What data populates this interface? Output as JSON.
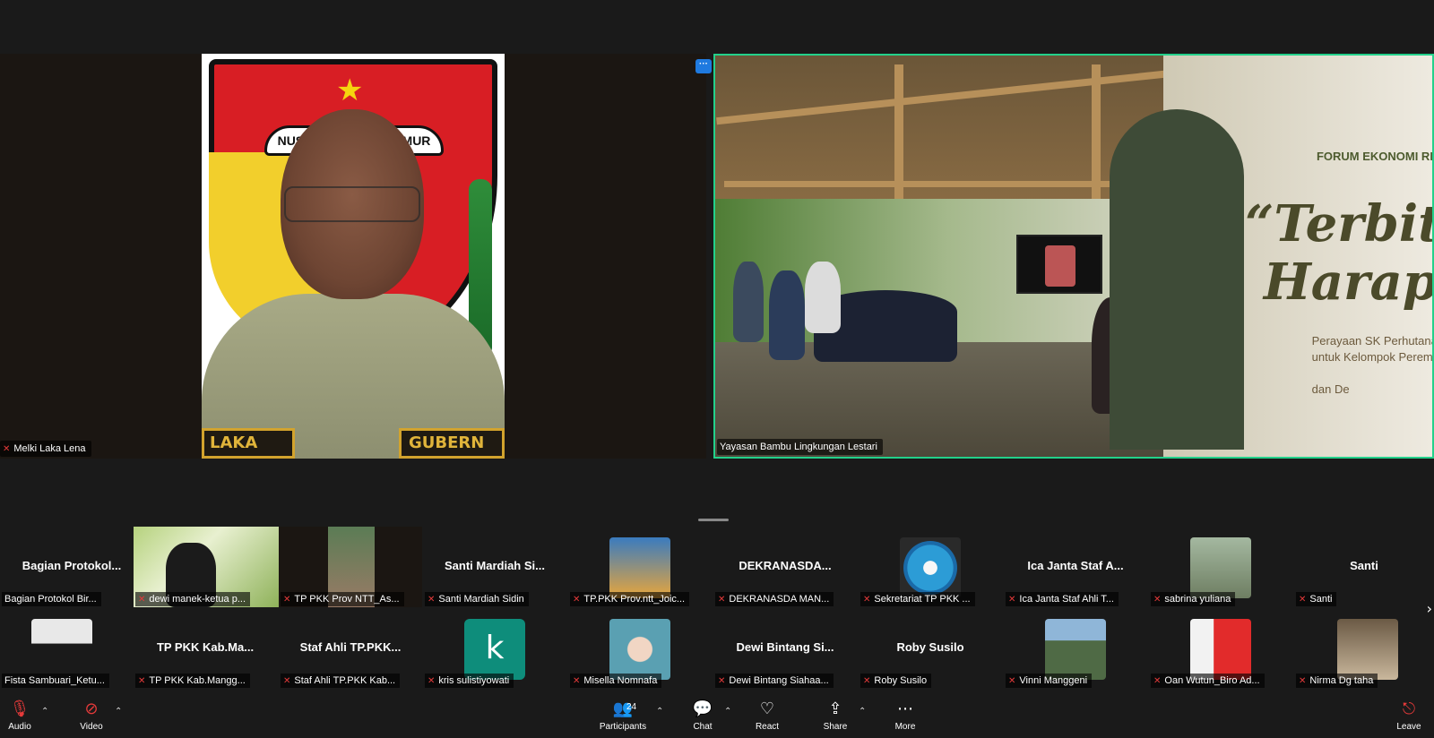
{
  "speakers": {
    "left": {
      "name": "Melki Laka Lena",
      "emblem_text": "NUSA TENGGARA TIMUR",
      "shirt_left": "LAKA LENA",
      "shirt_right": "GUBERN"
    },
    "right": {
      "name": "Yayasan Bambu Lingkungan Lestari",
      "poster_title": "FORUM EKONOMI RE",
      "poster_big1": "“Terbit",
      "poster_big2": "Harap",
      "poster_small": "Perayaan SK Perhutana\nuntuk Kelompok Peremp\n\ndan De"
    },
    "more_button": "···"
  },
  "gallery": {
    "row1": [
      {
        "display": "Bagian Protokol...",
        "label": "Bagian Protokol Bir...",
        "type": "name"
      },
      {
        "display": "",
        "label": "dewi manek-ketua p...",
        "type": "photo-grass"
      },
      {
        "display": "",
        "label": "TP PKK Prov NTT_As...",
        "type": "photo-dark"
      },
      {
        "display": "Santi Mardiah Si...",
        "label": "Santi Mardiah Sidin",
        "type": "name"
      },
      {
        "display": "",
        "label": "TP.PKK Prov.ntt_Joic...",
        "type": "photo-avatar"
      },
      {
        "display": "DEKRANASDA...",
        "label": "DEKRANASDA MAN...",
        "type": "name"
      },
      {
        "display": "",
        "label": "Sekretariat TP PKK ...",
        "type": "photo-logo"
      },
      {
        "display": "Ica Janta Staf A...",
        "label": "Ica Janta Staf Ahli T...",
        "type": "name"
      },
      {
        "display": "",
        "label": "sabrina yuliana",
        "type": "photo-outdoor"
      },
      {
        "display": "Santi",
        "label": "Santi",
        "type": "name"
      }
    ],
    "row2": [
      {
        "display": "",
        "label": "Fista Sambuari_Ketu...",
        "type": "photo-woman"
      },
      {
        "display": "TP PKK Kab.Ma...",
        "label": "TP PKK Kab.Mangg...",
        "type": "name"
      },
      {
        "display": "Staf Ahli TP.PKK...",
        "label": "Staf Ahli TP.PKK Kab...",
        "type": "name"
      },
      {
        "display": "k",
        "label": "kris sulistiyowati",
        "type": "letter"
      },
      {
        "display": "",
        "label": "Misella Nomnafa",
        "type": "photo-cartoon"
      },
      {
        "display": "Dewi Bintang Si...",
        "label": "Dewi Bintang Siahaa...",
        "type": "name"
      },
      {
        "display": "Roby Susilo",
        "label": "Roby Susilo",
        "type": "name"
      },
      {
        "display": "",
        "label": "Vinni Manggeni",
        "type": "photo-mountain"
      },
      {
        "display": "",
        "label": "Oan Wutun_Biro Ad...",
        "type": "photo-red"
      },
      {
        "display": "",
        "label": "Nirma Dg taha",
        "type": "photo-room"
      }
    ],
    "next_arrow": "›"
  },
  "toolbar": {
    "audio": "Audio",
    "video": "Video",
    "participants": "Participants",
    "participants_count": "24",
    "chat": "Chat",
    "react": "React",
    "share": "Share",
    "more": "More",
    "leave": "Leave"
  },
  "colors": {
    "active_speaker_border": "#23d18b",
    "muted_red": "#e53a3a",
    "background": "#1a1a1a"
  }
}
